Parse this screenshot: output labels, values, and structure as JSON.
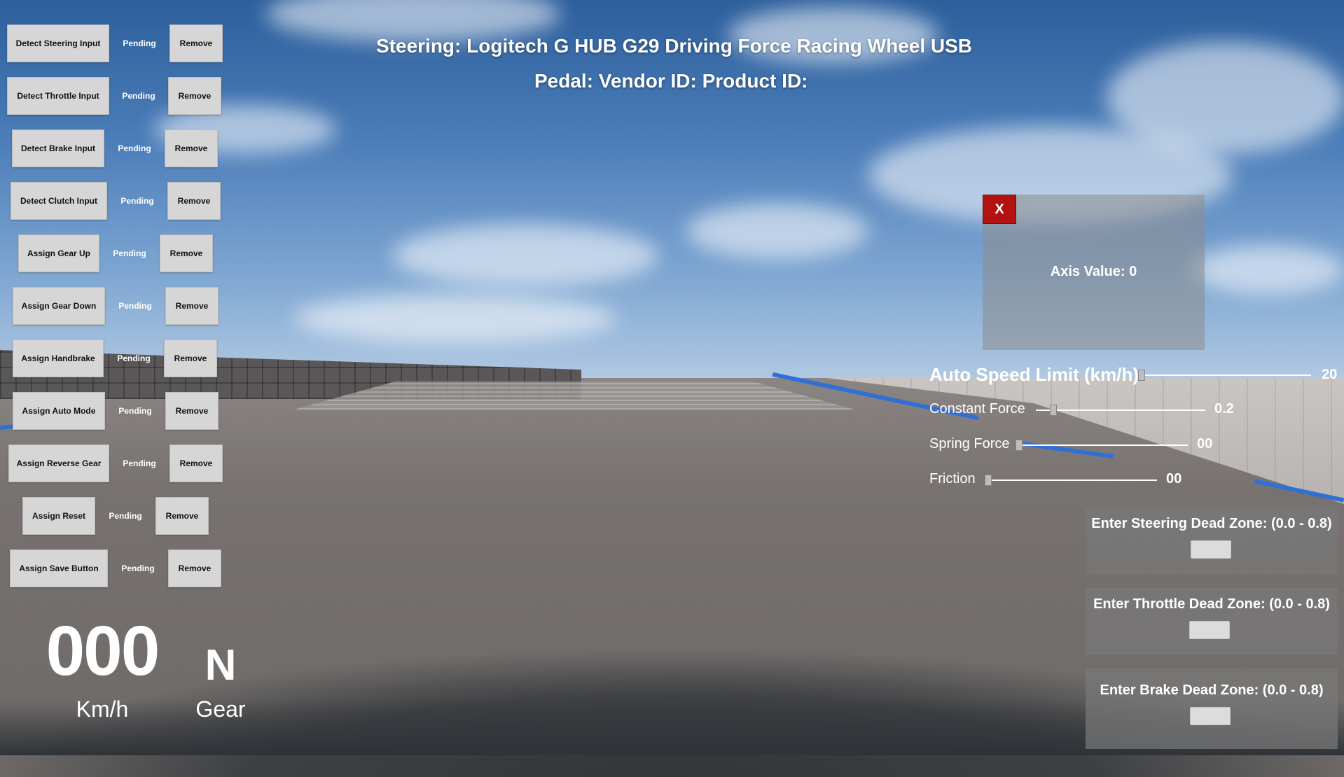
{
  "header": {
    "steering_line": "Steering: Logitech G HUB G29 Driving Force Racing Wheel USB",
    "pedal_line": "Pedal: Vendor ID: Product ID:"
  },
  "bindings": [
    {
      "label": "Detect Steering Input",
      "status": "Pending",
      "remove": "Remove"
    },
    {
      "label": "Detect Throttle Input",
      "status": "Pending",
      "remove": "Remove"
    },
    {
      "label": "Detect Brake Input",
      "status": "Pending",
      "remove": "Remove"
    },
    {
      "label": "Detect Clutch Input",
      "status": "Pending",
      "remove": "Remove"
    },
    {
      "label": "Assign Gear Up",
      "status": "Pending",
      "remove": "Remove"
    },
    {
      "label": "Assign Gear Down",
      "status": "Pending",
      "remove": "Remove"
    },
    {
      "label": "Assign Handbrake",
      "status": "Pending",
      "remove": "Remove"
    },
    {
      "label": "Assign Auto Mode",
      "status": "Pending",
      "remove": "Remove"
    },
    {
      "label": "Assign Reverse Gear",
      "status": "Pending",
      "remove": "Remove"
    },
    {
      "label": "Assign Reset",
      "status": "Pending",
      "remove": "Remove"
    },
    {
      "label": "Assign Save Button",
      "status": "Pending",
      "remove": "Remove"
    }
  ],
  "axis_panel": {
    "close_label": "X",
    "axis_value": "Axis Value: 0"
  },
  "sliders": {
    "auto_speed_limit": {
      "label": "Auto Speed Limit (km/h)",
      "value": "20",
      "fraction": 0.0
    },
    "constant_force": {
      "label": "Constant Force",
      "value": "0.2",
      "fraction": 0.1
    },
    "spring_force": {
      "label": "Spring Force",
      "value": "00",
      "fraction": 0.0
    },
    "friction": {
      "label": "Friction",
      "value": "00",
      "fraction": 0.0
    }
  },
  "dead_zones": {
    "steering": {
      "label": "Enter Steering Dead Zone: (0.0 - 0.8)",
      "value": ""
    },
    "throttle": {
      "label": "Enter Throttle Dead Zone: (0.0 - 0.8)",
      "value": ""
    },
    "brake": {
      "label": "Enter Brake Dead Zone: (0.0 - 0.8)",
      "value": ""
    }
  },
  "hud": {
    "speed": "000",
    "speed_unit": "Km/h",
    "gear": "N",
    "gear_unit": "Gear"
  },
  "colors": {
    "close_button": "#b21212",
    "button_bg": "#d6d6d6",
    "stripe": "#2f6fd6"
  }
}
